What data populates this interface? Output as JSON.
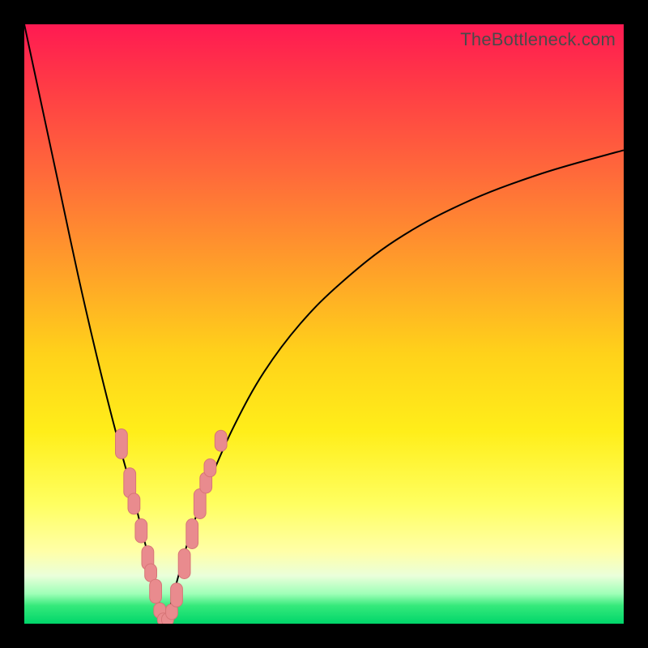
{
  "watermark": "TheBottleneck.com",
  "colors": {
    "frame_bg_top": "#ff1a52",
    "frame_bg_bottom": "#00d66a",
    "border": "#000000",
    "curve": "#000000",
    "marker_fill": "#e98b8e",
    "marker_stroke": "#d77577"
  },
  "chart_data": {
    "type": "line",
    "title": "",
    "xlabel": "",
    "ylabel": "",
    "xlim": [
      0,
      100
    ],
    "ylim": [
      0,
      100
    ],
    "legend": false,
    "grid": false,
    "series": [
      {
        "name": "bottleneck-curve",
        "x": [
          0,
          3,
          6,
          9,
          12,
          15,
          18,
          20,
          21.5,
          22.5,
          23.5,
          24.5,
          26,
          28,
          31,
          35,
          40,
          46,
          53,
          62,
          73,
          86,
          100
        ],
        "y": [
          100,
          86,
          72,
          58,
          45,
          33,
          22,
          14,
          8,
          3.5,
          0.5,
          3.5,
          9,
          16,
          24,
          33,
          42,
          50,
          57,
          64,
          70,
          75,
          79
        ]
      }
    ],
    "markers": [
      {
        "x": 16.2,
        "y": 30.0,
        "w": 2.0,
        "h": 5.0
      },
      {
        "x": 17.6,
        "y": 23.5,
        "w": 2.0,
        "h": 5.0
      },
      {
        "x": 18.3,
        "y": 20.0,
        "w": 2.0,
        "h": 3.5
      },
      {
        "x": 19.5,
        "y": 15.5,
        "w": 2.0,
        "h": 4.0
      },
      {
        "x": 20.6,
        "y": 11.0,
        "w": 2.0,
        "h": 4.0
      },
      {
        "x": 21.1,
        "y": 8.5,
        "w": 2.0,
        "h": 3.0
      },
      {
        "x": 21.9,
        "y": 5.4,
        "w": 2.0,
        "h": 4.0
      },
      {
        "x": 22.6,
        "y": 2.2,
        "w": 2.0,
        "h": 2.6
      },
      {
        "x": 23.2,
        "y": 0.7,
        "w": 2.0,
        "h": 2.2
      },
      {
        "x": 23.9,
        "y": 0.7,
        "w": 2.0,
        "h": 2.2
      },
      {
        "x": 24.6,
        "y": 2.0,
        "w": 2.0,
        "h": 2.6
      },
      {
        "x": 25.4,
        "y": 4.8,
        "w": 2.0,
        "h": 4.0
      },
      {
        "x": 26.7,
        "y": 10.0,
        "w": 2.0,
        "h": 5.0
      },
      {
        "x": 28.0,
        "y": 15.0,
        "w": 2.0,
        "h": 5.0
      },
      {
        "x": 29.3,
        "y": 20.0,
        "w": 2.0,
        "h": 5.0
      },
      {
        "x": 30.3,
        "y": 23.5,
        "w": 2.0,
        "h": 3.5
      },
      {
        "x": 31.0,
        "y": 26.0,
        "w": 2.0,
        "h": 3.0
      },
      {
        "x": 32.8,
        "y": 30.5,
        "w": 2.0,
        "h": 3.5
      }
    ]
  }
}
